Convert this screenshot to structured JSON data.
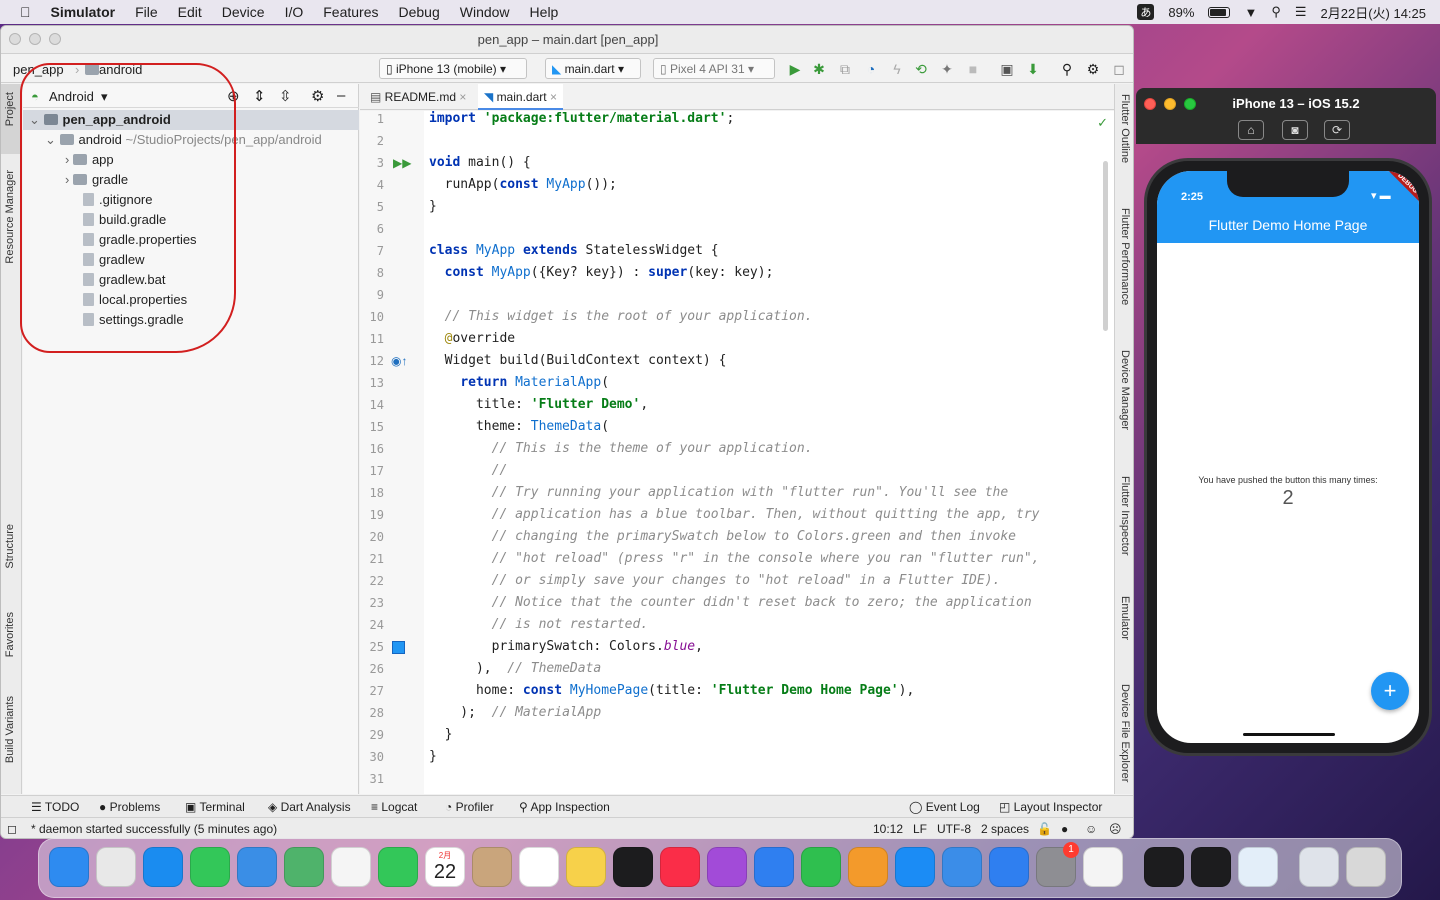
{
  "menubar": {
    "app": "Simulator",
    "items": [
      "File",
      "Edit",
      "Device",
      "I/O",
      "Features",
      "Debug",
      "Window",
      "Help"
    ],
    "ime": "あ",
    "battery": "89%",
    "datetime": "2月22日(火)  14:25"
  },
  "ide": {
    "title": "pen_app – main.dart [pen_app]",
    "breadcrumb": [
      "pen_app",
      "android"
    ],
    "device_combo": "iPhone 13 (mobile)",
    "run_config": "main.dart",
    "emulator_combo": "Pixel 4 API 31",
    "left_tabs": [
      "Project",
      "Resource Manager",
      "Structure",
      "Favorites",
      "Build Variants"
    ],
    "right_tabs": [
      "Flutter Outline",
      "Flutter Performance",
      "Device Manager",
      "Flutter Inspector",
      "Emulator",
      "Device File Explorer"
    ],
    "project_view": "Android",
    "tree": [
      {
        "label": "pen_app_android",
        "bold": true,
        "depth": 0,
        "kind": "module"
      },
      {
        "label": "android",
        "extra": "~/StudioProjects/pen_app/android",
        "depth": 1,
        "kind": "folder"
      },
      {
        "label": "app",
        "depth": 2,
        "kind": "folder"
      },
      {
        "label": "gradle",
        "depth": 2,
        "kind": "folder"
      },
      {
        "label": ".gitignore",
        "depth": 2,
        "kind": "file"
      },
      {
        "label": "build.gradle",
        "depth": 2,
        "kind": "file"
      },
      {
        "label": "gradle.properties",
        "depth": 2,
        "kind": "file"
      },
      {
        "label": "gradlew",
        "depth": 2,
        "kind": "file"
      },
      {
        "label": "gradlew.bat",
        "depth": 2,
        "kind": "file"
      },
      {
        "label": "local.properties",
        "depth": 2,
        "kind": "file"
      },
      {
        "label": "settings.gradle",
        "depth": 2,
        "kind": "file"
      }
    ],
    "tabs": [
      "README.md",
      "main.dart"
    ],
    "code": [
      "import 'package:flutter/material.dart';",
      "",
      "void main() {",
      "  runApp(const MyApp());",
      "}",
      "",
      "class MyApp extends StatelessWidget {",
      "  const MyApp({Key? key}) : super(key: key);",
      "",
      "  // This widget is the root of your application.",
      "  @override",
      "  Widget build(BuildContext context) {",
      "    return MaterialApp(",
      "      title: 'Flutter Demo',",
      "      theme: ThemeData(",
      "        // This is the theme of your application.",
      "        //",
      "        // Try running your application with \"flutter run\". You'll see the",
      "        // application has a blue toolbar. Then, without quitting the app, try",
      "        // changing the primarySwatch below to Colors.green and then invoke",
      "        // \"hot reload\" (press \"r\" in the console where you ran \"flutter run\",",
      "        // or simply save your changes to \"hot reload\" in a Flutter IDE).",
      "        // Notice that the counter didn't reset back to zero; the application",
      "        // is not restarted.",
      "        primarySwatch: Colors.blue,",
      "      ),  // ThemeData",
      "      home: const MyHomePage(title: 'Flutter Demo Home Page'),",
      "    );  // MaterialApp",
      "  }",
      "}",
      ""
    ],
    "bottom_tools": [
      "TODO",
      "Problems",
      "Terminal",
      "Dart Analysis",
      "Logcat",
      "Profiler",
      "App Inspection"
    ],
    "bottom_right_tools": [
      "Event Log",
      "Layout Inspector"
    ],
    "status_message": "* daemon started successfully (5 minutes ago)",
    "status_right": [
      "10:12",
      "LF",
      "UTF-8",
      "2 spaces"
    ]
  },
  "simulator": {
    "title": "iPhone 13 – iOS 15.2",
    "time": "2:25",
    "debug_banner": "DEBUG",
    "appbar_title": "Flutter Demo Home Page",
    "counter_label": "You have pushed the button this many times:",
    "counter_value": "2",
    "fab_label": "+"
  },
  "dock": {
    "calendar_month": "2月",
    "calendar_day": "22",
    "settings_badge": "1",
    "apps": [
      "Finder",
      "Launchpad",
      "Safari",
      "Messages",
      "Mail",
      "Maps",
      "Photos",
      "FaceTime",
      "Calendar",
      "Contacts",
      "Reminders",
      "Notes",
      "TV",
      "Music",
      "Podcasts",
      "Keynote",
      "Numbers",
      "Pages",
      "App Store",
      "Xcode",
      "Simulator",
      "System Preferences",
      "Chrome",
      "Terminal",
      "Activity Monitor",
      "Android Studio",
      "Downloads",
      "Trash"
    ],
    "colors": [
      "#2e8bf0",
      "#e8e8e8",
      "#1a8cf0",
      "#33c759",
      "#3a8ee6",
      "#4fb36b",
      "#f5f5f5",
      "#33c759",
      "#ffffff",
      "#c9a57c",
      "#ffffff",
      "#f7d14a",
      "#1c1c1e",
      "#fa2d48",
      "#a24bd8",
      "#2f7ff0",
      "#2fbf4f",
      "#f39a2b",
      "#1b8cf5",
      "#3b8de8",
      "#2f7ff0",
      "#8e8e93",
      "#f4f4f4",
      "#1c1c1e",
      "#1c1c1e",
      "#e3eef9",
      "#dfe3ea",
      "#d8d8d8"
    ]
  }
}
